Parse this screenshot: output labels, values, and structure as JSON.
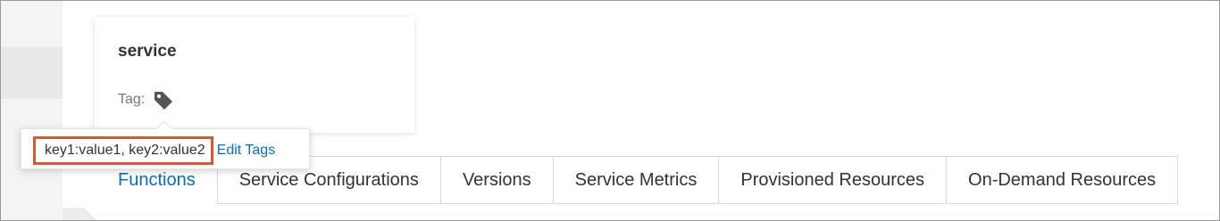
{
  "service": {
    "title": "service",
    "tag_label": "Tag:",
    "tag_icon": "tag-icon"
  },
  "popover": {
    "tags_text": "key1:value1, key2:value2",
    "edit_tags_label": "Edit Tags"
  },
  "tabs": [
    {
      "label": "Functions",
      "active": true
    },
    {
      "label": "Service Configurations",
      "active": false
    },
    {
      "label": "Versions",
      "active": false
    },
    {
      "label": "Service Metrics",
      "active": false
    },
    {
      "label": "Provisioned Resources",
      "active": false
    },
    {
      "label": "On-Demand Resources",
      "active": false
    }
  ],
  "colors": {
    "accent": "#0070cc",
    "highlight_border": "#e0552b",
    "tag_icon": "#555555"
  }
}
